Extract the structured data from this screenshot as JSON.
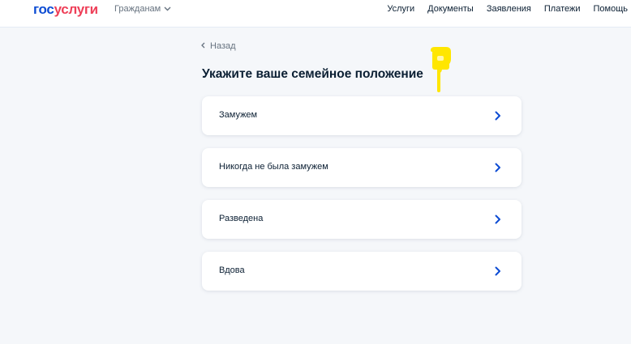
{
  "header": {
    "logo_part1": "гос",
    "logo_part2": "услуги",
    "citizens_label": "Гражданам",
    "nav": [
      "Услуги",
      "Документы",
      "Заявления",
      "Платежи",
      "Помощь"
    ]
  },
  "main": {
    "back_label": "Назад",
    "title": "Укажите ваше семейное положение",
    "options": [
      "Замужем",
      "Никогда не была замужем",
      "Разведена",
      "Вдова"
    ]
  },
  "colors": {
    "brand_blue": "#0d4cd3",
    "brand_red": "#ee3f58",
    "background": "#f5f7fa",
    "text": "#0b1f33",
    "chevron": "#0d4cd3",
    "marker": "#ffe600"
  },
  "icons": [
    "chevron-down-icon",
    "back-chevron-icon",
    "chevron-right-icon"
  ]
}
